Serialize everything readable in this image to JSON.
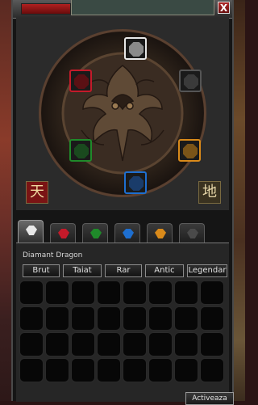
{
  "window": {
    "close_label": "X",
    "heaven_glyph": "天",
    "earth_glyph": "地"
  },
  "colors": {
    "red": "#c41a2a",
    "green": "#1f8a2a",
    "blue": "#1e6fd0",
    "orange": "#d98a1a",
    "black": "#2a2a2a",
    "white": "#e8e8e8"
  },
  "slots": [
    {
      "name": "white-dragon-stone-slot",
      "color": "white"
    },
    {
      "name": "black-dragon-stone-slot",
      "color": "black"
    },
    {
      "name": "orange-dragon-stone-slot",
      "color": "orange"
    },
    {
      "name": "blue-dragon-stone-slot",
      "color": "blue"
    },
    {
      "name": "green-dragon-stone-slot",
      "color": "green"
    },
    {
      "name": "red-dragon-stone-slot",
      "color": "red"
    }
  ],
  "tabs": [
    {
      "name": "tab-diamond",
      "icon": "diamond-icon",
      "active": true
    },
    {
      "name": "tab-ruby",
      "icon": "ruby-icon"
    },
    {
      "name": "tab-jade",
      "icon": "jade-icon"
    },
    {
      "name": "tab-sapphire",
      "icon": "sapphire-icon"
    },
    {
      "name": "tab-garnet",
      "icon": "garnet-icon"
    },
    {
      "name": "tab-onyx",
      "icon": "onyx-icon"
    }
  ],
  "inventory": {
    "title": "Diamant Dragon",
    "filters": [
      "Brut",
      "Taiat",
      "Rar",
      "Antic",
      "Legendar"
    ],
    "activate_label": "Activeaza"
  }
}
